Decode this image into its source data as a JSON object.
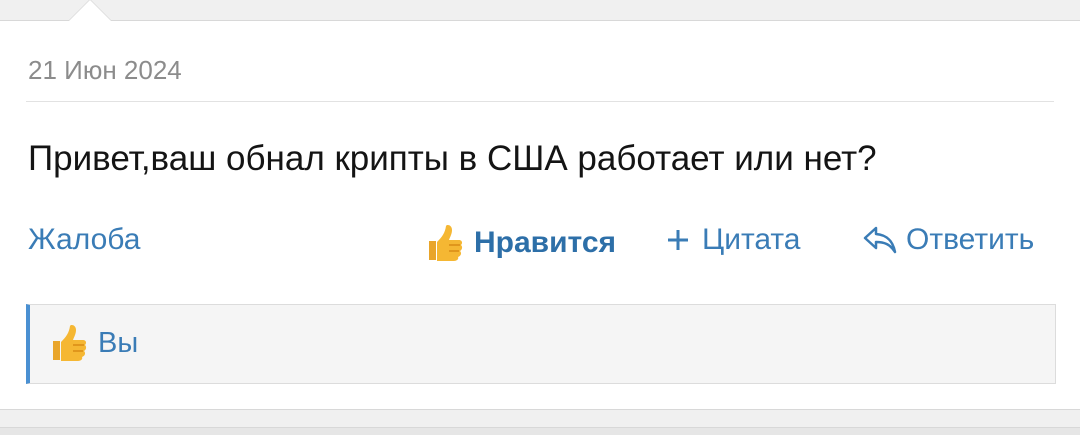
{
  "post": {
    "date": "21 Июн 2024",
    "message": "Привет,ваш обнал крипты в США работает или нет?"
  },
  "actions": {
    "report_label": "Жалоба",
    "like_label": "Нравится",
    "quote_label": "Цитата",
    "reply_label": "Ответить",
    "quote_icon": "plus-icon",
    "reply_icon": "reply-arrow-icon",
    "like_icon": "thumbs-up-icon"
  },
  "likes": {
    "text": "Вы",
    "icon": "thumbs-up-icon"
  },
  "colors": {
    "link": "#3a7cb6",
    "accent_bar": "#4a90d2",
    "date_text": "#8c8c8c",
    "thumb": "#f5b733"
  }
}
